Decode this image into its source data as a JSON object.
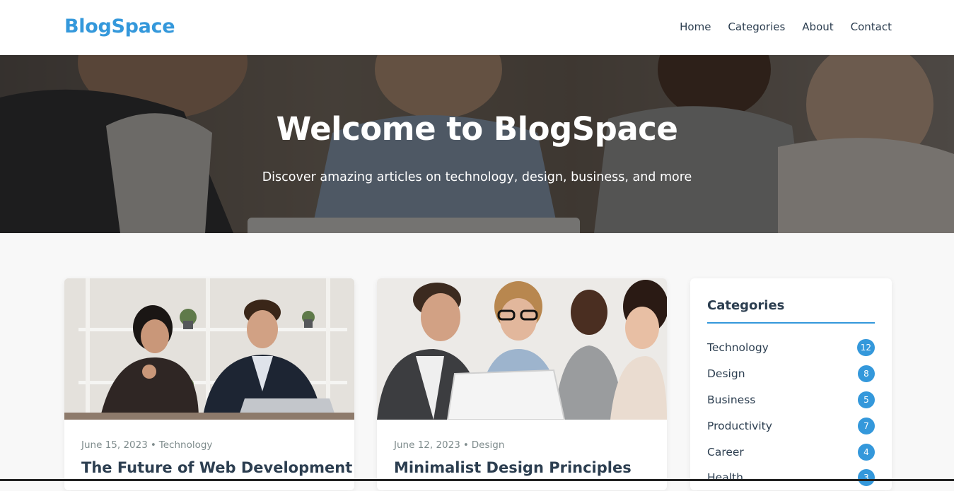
{
  "header": {
    "logo": "BlogSpace",
    "nav": [
      "Home",
      "Categories",
      "About",
      "Contact"
    ]
  },
  "hero": {
    "title": "Welcome to BlogSpace",
    "subtitle": "Discover amazing articles on technology, design, business, and more"
  },
  "posts": [
    {
      "date": "June 15, 2023",
      "separator": "•",
      "category": "Technology",
      "title": "The Future of Web Development",
      "image_icon": "office-meeting-photo"
    },
    {
      "date": "June 12, 2023",
      "separator": "•",
      "category": "Design",
      "title": "Minimalist Design Principles",
      "image_icon": "team-laptop-photo"
    }
  ],
  "sidebar": {
    "title": "Categories",
    "categories": [
      {
        "name": "Technology",
        "count": "12"
      },
      {
        "name": "Design",
        "count": "8"
      },
      {
        "name": "Business",
        "count": "5"
      },
      {
        "name": "Productivity",
        "count": "7"
      },
      {
        "name": "Career",
        "count": "4"
      },
      {
        "name": "Health",
        "count": "3"
      }
    ]
  },
  "colors": {
    "accent": "#3498db",
    "text": "#2c3e50",
    "muted": "#7f8c8d",
    "background": "#f8f8f8"
  }
}
